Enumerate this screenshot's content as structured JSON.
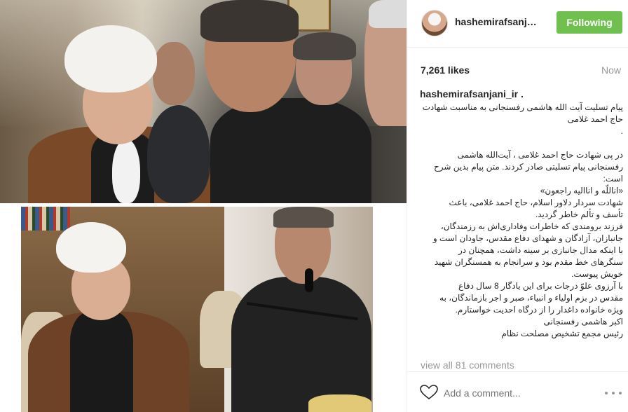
{
  "post": {
    "username": "hashemirafsanja...",
    "follow_label": "Following",
    "likes": "7,261 likes",
    "time": "Now"
  },
  "caption": {
    "username": "hashemirafsanjani_ir .",
    "lines": [
      "پیام تسلیت آیت الله هاشمی رفسنجانی به مناسبت شهادت",
      "حاج احمد غلامی",
      ".",
      "",
      "در پی شهادت حاج احمد غلامی ، آیت‌الله هاشمی",
      "رفسنجانی پیام تسلیتی صادر کردند. متن پیام بدین شرح",
      "است:",
      "«اناللّه و اناالیه راجعون»",
      "شهادت سردار دلاور اسلام، حاج احمد غلامی، باعث",
      "تأسف و تألم خاطر گردید.",
      "فرزند برومندی که خاطرات وفاداری‌اش به رزمندگان،",
      "جانبازان، آزادگان و شهدای دفاع مقدس، جاودان است و",
      "با اینکه مدال جانبازی بر سینه داشت، همچنان در",
      "سنگرهای خط مقدم بود و سرانجام به همسنگران شهید",
      "خویش پیوست.",
      "با آرزوی علوّ درجات برای این یادگار 8 سال دفاع",
      "مقدس در بزم اولیاء و انبیاء، صبر و اجر بازماندگان، به",
      "ویژه خانواده داغدار را از درگاه احدیت خواستارم.",
      "اکبر هاشمی رفسنجانی",
      "رئیس مجمع تشخیص مصلحت نظام"
    ],
    "view_all": "view all 81 comments"
  },
  "footer": {
    "comment_placeholder": "Add a comment..."
  },
  "icons": {
    "like": "heart-icon",
    "more": "more-options-icon"
  },
  "colors": {
    "follow_button": "#70c050",
    "muted_text": "#999999"
  }
}
